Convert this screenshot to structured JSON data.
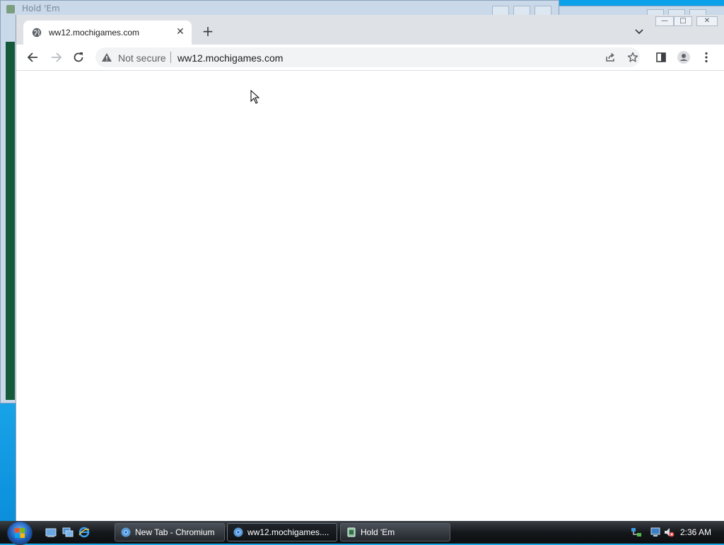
{
  "background_window": {
    "title": "Hold 'Em"
  },
  "browser": {
    "tab": {
      "title": "ww12.mochigames.com",
      "close": "✕"
    },
    "new_tab": "+",
    "omnibox": {
      "security_label": "Not secure",
      "url": "ww12.mochigames.com"
    }
  },
  "taskbar": {
    "tasks": [
      {
        "label": "New Tab - Chromium"
      },
      {
        "label": "ww12.mochigames...."
      },
      {
        "label": "Hold 'Em"
      }
    ],
    "clock": "2:36 AM"
  }
}
